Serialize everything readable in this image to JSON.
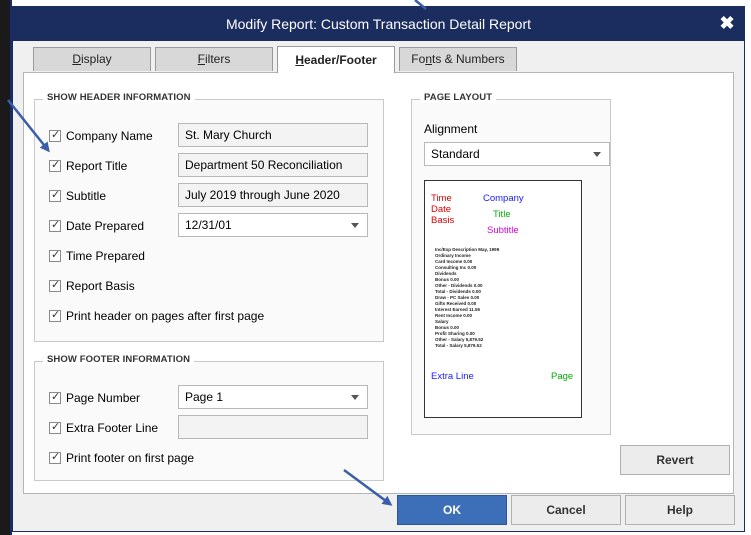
{
  "window": {
    "title": "Modify Report: Custom Transaction Detail Report",
    "close_glyph": "✖"
  },
  "tabs": [
    {
      "label": "Display",
      "u": "D",
      "rest": "isplay"
    },
    {
      "label": "Filters",
      "u": "F",
      "rest": "ilters"
    },
    {
      "label": "Header/Footer",
      "u": "H",
      "rest": "eader/Footer"
    },
    {
      "label": "Fonts & Numbers",
      "pre": "Fo",
      "u": "n",
      "rest": "ts & Numbers"
    }
  ],
  "active_tab": "Header/Footer",
  "header_section": {
    "title": "SHOW HEADER INFORMATION",
    "company_name": {
      "label": "Company Name",
      "checked": true,
      "value": "St. Mary Church"
    },
    "report_title": {
      "label": "Report Title",
      "checked": true,
      "value": "Department 50 Reconciliation"
    },
    "subtitle": {
      "label": "Subtitle",
      "checked": true,
      "value": "July 2019 through June 2020"
    },
    "date_prepared": {
      "label": "Date Prepared",
      "checked": true,
      "value": "12/31/01"
    },
    "time_prepared": {
      "label": "Time Prepared",
      "checked": true
    },
    "report_basis": {
      "label": "Report Basis",
      "checked": true
    },
    "print_header": {
      "label": "Print header on pages after first page",
      "checked": true
    }
  },
  "footer_section": {
    "title": "SHOW FOOTER INFORMATION",
    "page_number": {
      "label": "Page Number",
      "checked": true,
      "value": "Page 1"
    },
    "extra_footer": {
      "label": "Extra Footer Line",
      "checked": true,
      "value": ""
    },
    "print_footer": {
      "label": "Print footer on first page",
      "checked": true
    }
  },
  "page_layout": {
    "title": "PAGE LAYOUT",
    "alignment_label": "Alignment",
    "alignment_value": "Standard",
    "preview": {
      "time": "Time",
      "date": "Date",
      "basis": "Basis",
      "company": "Company",
      "title": "Title",
      "subtitle": "Subtitle",
      "extra_line": "Extra Line",
      "page": "Page",
      "body_lines": [
        "Inc/Exp Description          May, 1999",
        "Ordinary Income",
        "   Card Income                        0.00",
        "   Consulting Inc                     0.00",
        "   Dividends",
        "      Bonus                    0.00",
        "      Other - Dividends        0.00",
        "   Total - Dividends                 0.00",
        "   Draw - PC Sales                   0.00",
        "   Gifts Received                    0.00",
        "   Interest Earned                  11.55",
        "   Rent Income                       0.00",
        "   Salary",
        "      Bonus                    0.00",
        "      Profit Sharing           0.00",
        "      Other - Salary       5,879.52",
        "   Total - Salary                5,879.52"
      ]
    }
  },
  "buttons": {
    "revert": "Revert",
    "ok": "OK",
    "cancel": "Cancel",
    "help": "Help"
  },
  "colors": {
    "titlebar": "#1b2c5f",
    "ok_button": "#3d6fb8",
    "arrow": "#3a5ea8",
    "preview_red": "#e00000",
    "preview_blue": "#1a1aff",
    "preview_green": "#00b000",
    "preview_magenta": "#e000e0"
  },
  "icons": {
    "close": "close-icon",
    "dropdown": "chevron-down-icon",
    "checkbox": "checkmark-icon"
  }
}
